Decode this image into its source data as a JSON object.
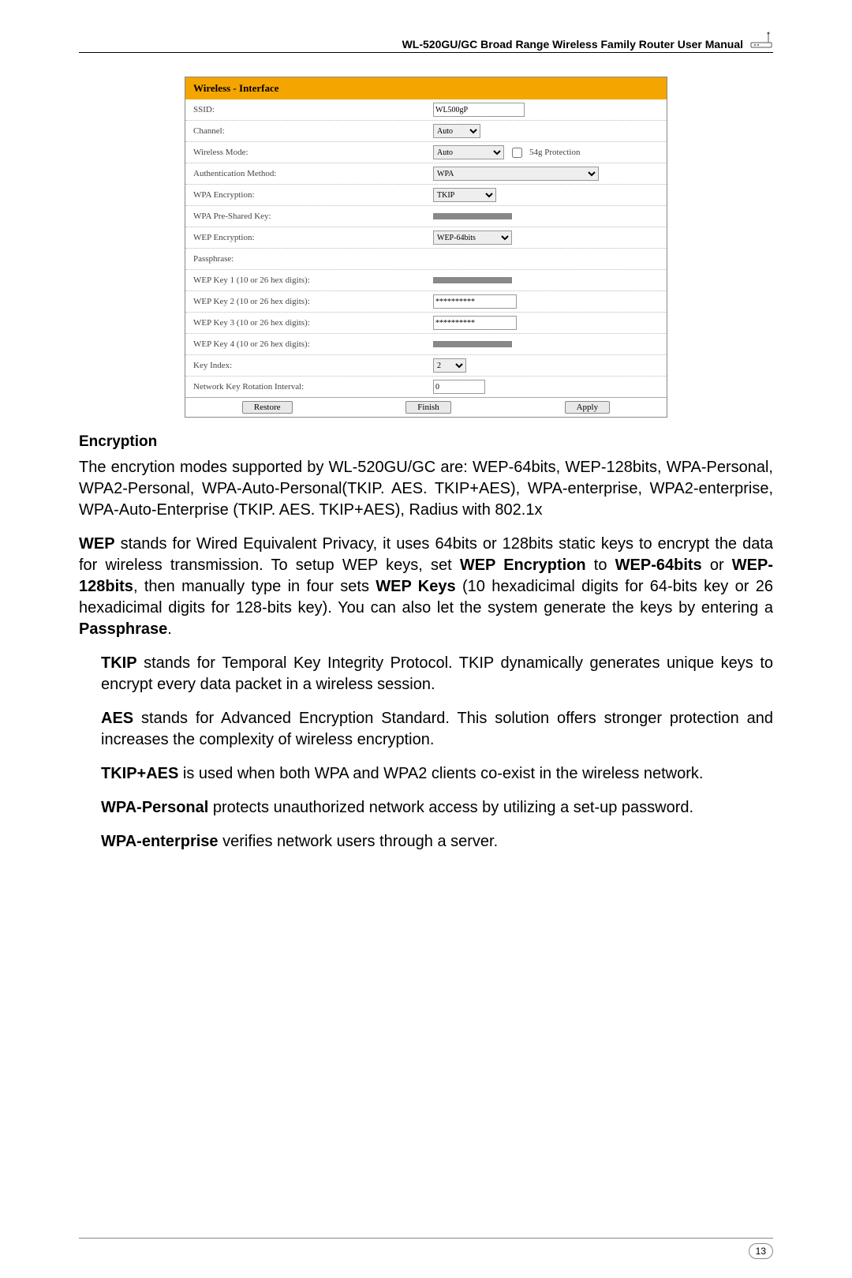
{
  "header": {
    "title": "WL-520GU/GC Broad Range Wireless Family Router User Manual"
  },
  "panel": {
    "title": "Wireless - Interface",
    "rows": {
      "ssid": {
        "label": "SSID:",
        "value": "WL500gP"
      },
      "channel": {
        "label": "Channel:",
        "value": "Auto"
      },
      "mode": {
        "label": "Wireless Mode:",
        "value": "Auto",
        "extra": "54g Protection"
      },
      "auth": {
        "label": "Authentication Method:",
        "value": "WPA"
      },
      "wpaenc": {
        "label": "WPA Encryption:",
        "value": "TKIP"
      },
      "psk": {
        "label": "WPA Pre-Shared Key:"
      },
      "wepenc": {
        "label": "WEP Encryption:",
        "value": "WEP-64bits"
      },
      "pass": {
        "label": "Passphrase:"
      },
      "k1": {
        "label": "WEP Key 1 (10 or 26 hex digits):"
      },
      "k2": {
        "label": "WEP Key 2 (10 or 26 hex digits):",
        "value": "**********"
      },
      "k3": {
        "label": "WEP Key 3 (10 or 26 hex digits):",
        "value": "**********"
      },
      "k4": {
        "label": "WEP Key 4 (10 or 26 hex digits):"
      },
      "kidx": {
        "label": "Key Index:",
        "value": "2"
      },
      "rot": {
        "label": "Network Key Rotation Interval:",
        "value": "0"
      }
    },
    "buttons": {
      "restore": "Restore",
      "finish": "Finish",
      "apply": "Apply"
    }
  },
  "section": {
    "heading": "Encryption"
  },
  "para": {
    "p1a": "The encrytion modes supported by WL-520GU/GC are: WEP-64bits, WEP-128bits, WPA-Personal, WPA2-Personal, WPA-Auto-Personal(TKIP. AES. TKIP+AES), WPA-enterprise, WPA2-enterprise, WPA-Auto-Enterprise (TKIP. AES. TKIP+AES), Radius with 802.1x",
    "p2_wep": "WEP",
    "p2a": " stands for Wired Equivalent Privacy, it uses 64bits or 128bits static keys to encrypt the data for wireless transmission. To setup WEP keys, set ",
    "p2b": "WEP Encryption",
    "p2c": " to ",
    "p2d": "WEP-64bits",
    "p2e": " or ",
    "p2f": "WEP-128bits",
    "p2g": ", then manually type in four sets ",
    "p2h": "WEP Keys",
    "p2i": " (10 hexadicimal digits for 64-bits key or 26 hexadicimal digits for 128-bits key). You can also let the system generate the keys by entering a ",
    "p2j": "Passphrase",
    "p2k": ".",
    "p3a": "TKIP",
    "p3b": " stands for Temporal Key Integrity Protocol. TKIP dynamically generates unique keys to encrypt every data packet in a wireless session.",
    "p4a": "AES",
    "p4b": " stands for Advanced Encryption Standard. This solution offers stronger protection and increases the complexity of wireless encryption.",
    "p5a": "TKIP+AES",
    "p5b": " is used when both WPA and WPA2 clients co-exist in the wireless network.",
    "p6a": "WPA-Personal",
    "p6b": " protects unauthorized network access by utilizing a set-up password.",
    "p7a": "WPA-enterprise",
    "p7b": " verifies network users through a server."
  },
  "footer": {
    "page": "13"
  }
}
